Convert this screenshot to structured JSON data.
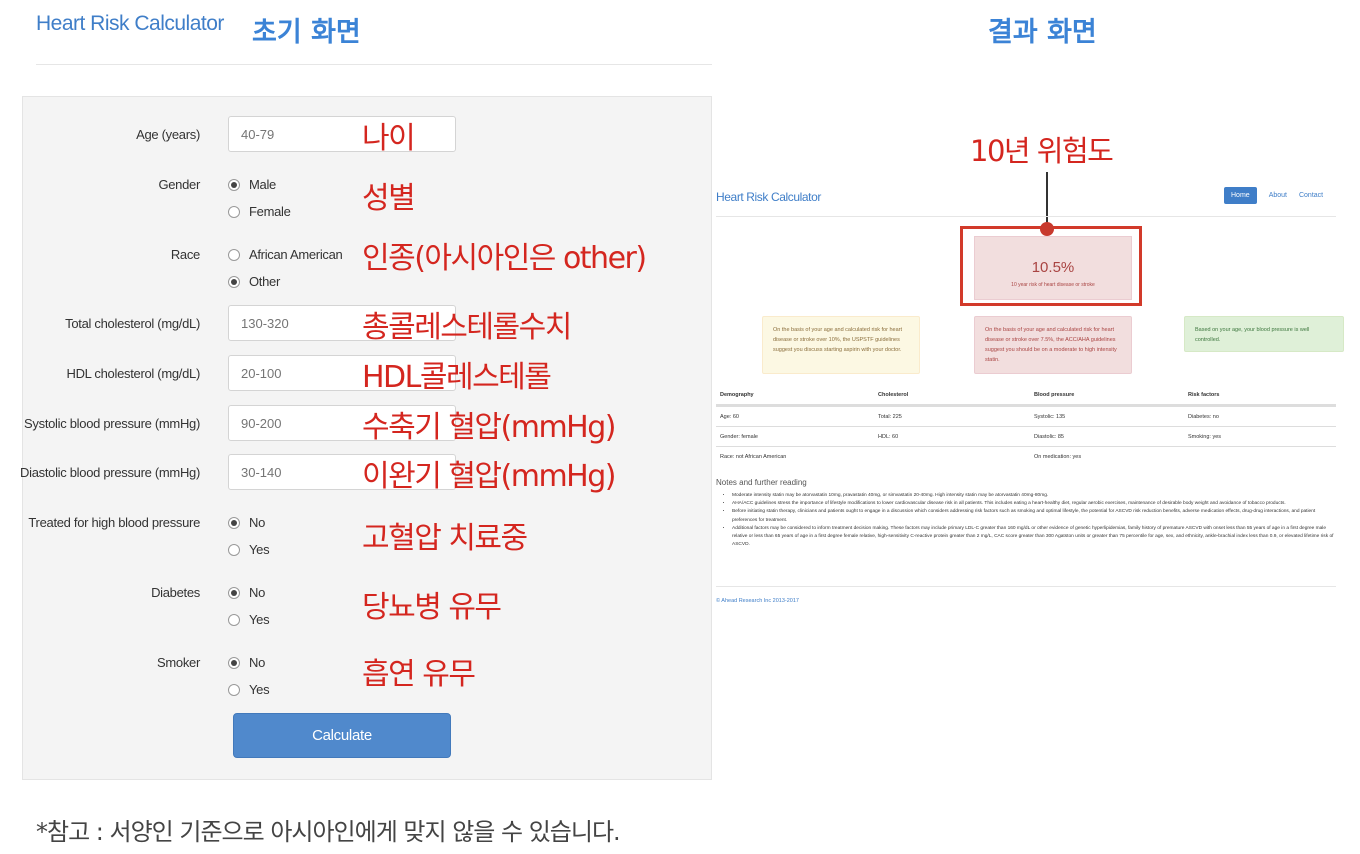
{
  "header": {
    "app_title": "Heart Risk Calculator",
    "left_section": "초기 화면",
    "right_section": "결과 화면"
  },
  "form": {
    "age": {
      "label": "Age (years)",
      "placeholder": "40-79",
      "annotation": "나이"
    },
    "gender": {
      "label": "Gender",
      "options": [
        "Male",
        "Female"
      ],
      "selected": "Male",
      "annotation": "성별"
    },
    "race": {
      "label": "Race",
      "options": [
        "African American",
        "Other"
      ],
      "selected": "Other",
      "annotation": "인종(아시아인은 other)"
    },
    "total_chol": {
      "label": "Total cholesterol (mg/dL)",
      "placeholder": "130-320",
      "annotation": "총콜레스테롤수치"
    },
    "hdl": {
      "label": "HDL cholesterol (mg/dL)",
      "placeholder": "20-100",
      "annotation": "HDL콜레스테롤"
    },
    "systolic": {
      "label": "Systolic blood pressure (mmHg)",
      "placeholder": "90-200",
      "annotation": "수축기 혈압(mmHg)"
    },
    "diastolic": {
      "label": "Diastolic blood pressure (mmHg)",
      "placeholder": "30-140",
      "annotation": "이완기 혈압(mmHg)"
    },
    "treated": {
      "label": "Treated for high blood pressure",
      "options": [
        "No",
        "Yes"
      ],
      "selected": "No",
      "annotation": "고혈압 치료중"
    },
    "diabetes": {
      "label": "Diabetes",
      "options": [
        "No",
        "Yes"
      ],
      "selected": "No",
      "annotation": "당뇨병 유무"
    },
    "smoker": {
      "label": "Smoker",
      "options": [
        "No",
        "Yes"
      ],
      "selected": "No",
      "annotation": "흡연 유무"
    },
    "calculate_label": "Calculate"
  },
  "footnote": "*참고 : 서양인 기준으로 아시아인에게 맞지 않을 수 있습니다.",
  "result": {
    "annotation_title": "10년 위험도",
    "nav_title": "Heart Risk Calculator",
    "nav": [
      "Home",
      "About",
      "Contact"
    ],
    "risk_value": "10.5%",
    "risk_sub": "10 year risk of heart disease or stroke",
    "alert_warn": "On the basis of your age and calculated risk for heart disease or stroke over 10%, the USPSTF guidelines suggest you discuss starting aspirin with your doctor.",
    "alert_red": "On the basis of your age and calculated risk for heart disease or stroke over 7.5%, the ACC/AHA guidelines suggest you should be on a moderate to high intensity statin.",
    "alert_green": "Based on your age, your blood pressure is well controlled.",
    "table": {
      "headers": [
        "Demography",
        "Cholesterol",
        "Blood pressure",
        "Risk factors"
      ],
      "rows": [
        [
          "Age: 60",
          "Total: 225",
          "Systolic: 135",
          "Diabetes: no"
        ],
        [
          "Gender: female",
          "HDL: 60",
          "Diastolic: 85",
          "Smoking: yes"
        ],
        [
          "Race: not African American",
          "",
          "On medication: yes",
          ""
        ]
      ]
    },
    "notes_title": "Notes and further reading",
    "notes": [
      "Moderate intensity statin may be atorvastatin 10mg, pravastatin 40mg, or simvastatin 20-40mg. High intensity statin may be atorvastatin 40mg-80mg.",
      "AHA/ACC guidelines stress the importance of lifestyle modifications to lower cardiovascular disease risk in all patients. This includes eating a heart-healthy diet, regular aerobic exercises, maintenance of desirable body weight and avoidance of tobacco products.",
      "Before initiating statin therapy, clinicians and patients ought to engage in a discussion which considers addressing risk factors such as smoking and optimal lifestyle, the potential for ASCVD risk reduction benefits, adverse medication effects, drug-drug interactions, and patient preferences for treatment.",
      "Additional factors may be considered to inform treatment decision making. These factors may include primary LDL-C greater than 160 mg/dL or other evidence of genetic hyperlipidemias, family history of premature ASCVD with onset less than 55 years of age in a first degree male relative or less than 65 years of age in a first degree female relative, high-sensitivity C-reactive protein greater than 2 mg/L, CAC score greater than 300 Agatston units or greater than 75 percentile for age, sex, and ethnicity, ankle-brachial index less than 0.9, or elevated lifetime risk of ASCVD."
    ],
    "copyright": "© Ahead Research Inc 2013-2017"
  }
}
